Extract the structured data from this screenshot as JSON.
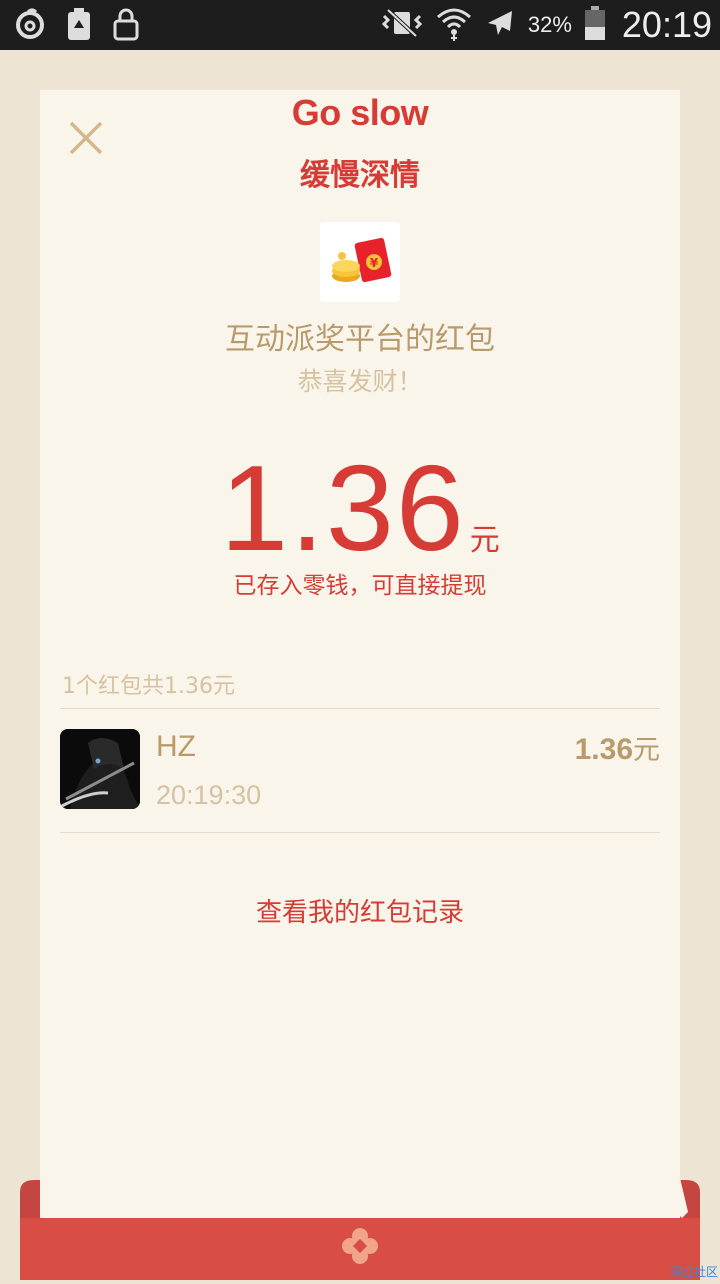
{
  "status_bar": {
    "battery_percent": "32%",
    "time": "20:19",
    "icons": [
      "netease-music-icon",
      "battery-saver-icon",
      "lock-icon",
      "vibrate-mute-icon",
      "wifi-icon",
      "airplane-icon",
      "battery-icon"
    ]
  },
  "header": {
    "title_en": "Go slow",
    "title_cn": "缓慢深情"
  },
  "packet": {
    "sender": "互动派奖平台的红包",
    "greeting": "恭喜发财！",
    "amount": "1.36",
    "unit": "元",
    "saved_note": "已存入零钱，可直接提现"
  },
  "summary": {
    "count_text": "1个红包共1.36元"
  },
  "receivers": [
    {
      "name": "HZ",
      "time": "20:19:30",
      "amount": "1.36",
      "unit": "元"
    }
  ],
  "actions": {
    "records_link": "查看我的红包记录"
  },
  "watermark": "深度社区",
  "colors": {
    "accent_red": "#d63b36",
    "gold": "#b99a6c",
    "background": "#ede4d3",
    "card": "#faf5eb"
  }
}
